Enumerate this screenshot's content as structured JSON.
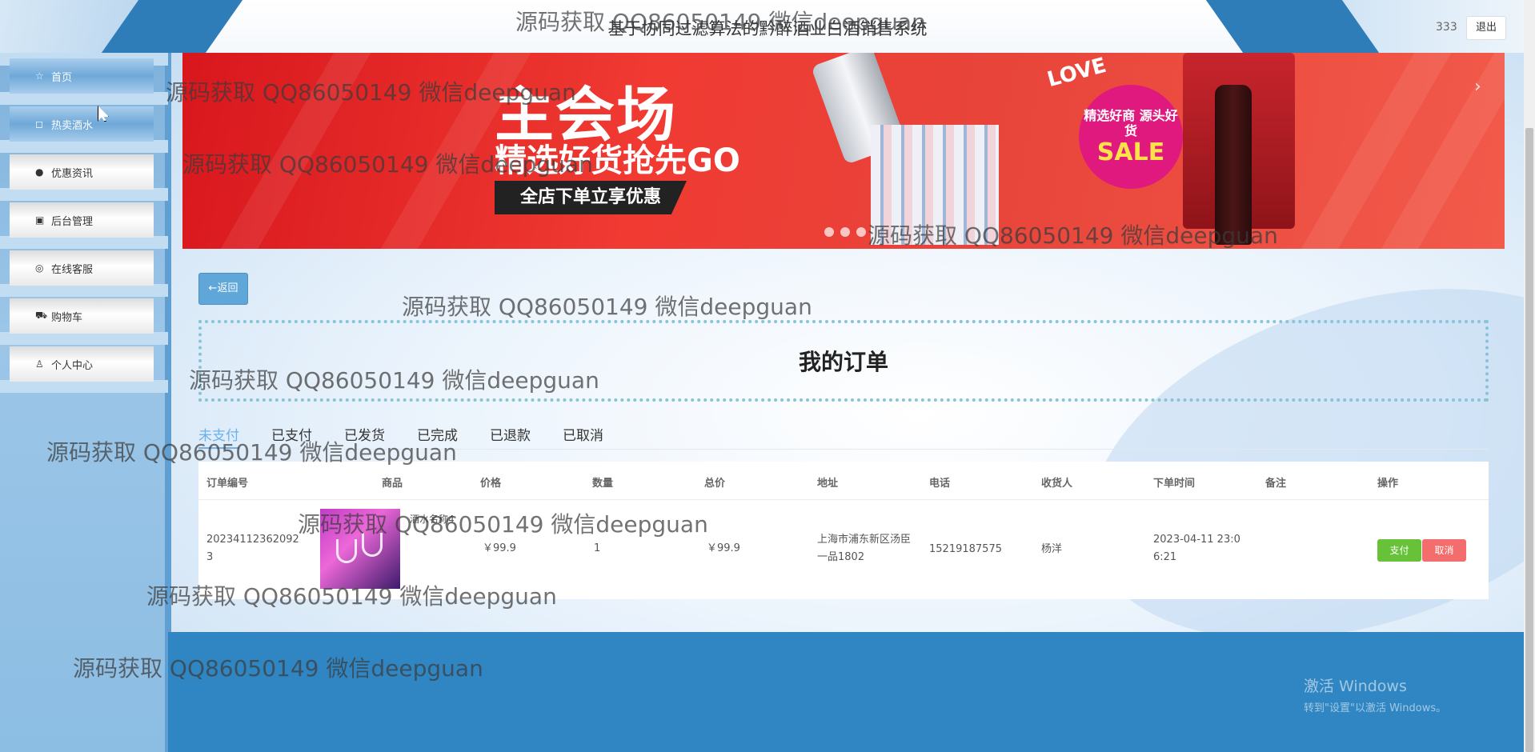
{
  "header": {
    "title": "基于协同过滤算法的黔醉酒业白酒销售系统",
    "username": "333",
    "logout_label": "退出"
  },
  "sidebar": {
    "items": [
      {
        "label": "首页",
        "icon": "home-icon",
        "glyph": "☆"
      },
      {
        "label": "热卖酒水",
        "icon": "bag-icon",
        "glyph": "◻"
      },
      {
        "label": "优惠资讯",
        "icon": "info-icon",
        "glyph": "●"
      },
      {
        "label": "后台管理",
        "icon": "briefcase-icon",
        "glyph": "▣"
      },
      {
        "label": "在线客服",
        "icon": "headset-icon",
        "glyph": "◎"
      },
      {
        "label": "购物车",
        "icon": "cart-icon",
        "glyph": "⛟"
      },
      {
        "label": "个人中心",
        "icon": "user-icon",
        "glyph": "♙"
      }
    ]
  },
  "banner": {
    "title": "主会场",
    "subtitle": "精选好货抢先GO",
    "tag": "全店下单立享优惠",
    "sale_top": "精选好商 源头好货",
    "sale": "SALE",
    "love": "LOVE"
  },
  "page": {
    "back_label": "←返回",
    "title": "我的订单"
  },
  "tabs": [
    "未支付",
    "已支付",
    "已发货",
    "已完成",
    "已退款",
    "已取消"
  ],
  "active_tab": "未支付",
  "table": {
    "headers": [
      "订单编号",
      "商品",
      "价格",
      "数量",
      "总价",
      "地址",
      "电话",
      "收货人",
      "下单时间",
      "备注",
      "操作"
    ],
    "rows": [
      {
        "order_no": "20234112362092 3",
        "product_name": "酒水名称4",
        "price": "￥99.9",
        "quantity": "1",
        "total": "￥99.9",
        "address": "上海市浦东新区汤臣一品1802",
        "phone": "15219187575",
        "receiver": "杨洋",
        "order_time": "2023-04-11 23:06:21",
        "remark": "",
        "pay_label": "支付",
        "cancel_label": "取消"
      }
    ]
  },
  "watermark": "源码获取 QQ86050149 微信deepguan",
  "windows": {
    "line1": "激活 Windows",
    "line2": "转到\"设置\"以激活 Windows。"
  },
  "colors": {
    "accent": "#6cb2e8",
    "footer": "#2f86c2",
    "pay": "#67c23a",
    "cancel": "#f56c6c"
  }
}
